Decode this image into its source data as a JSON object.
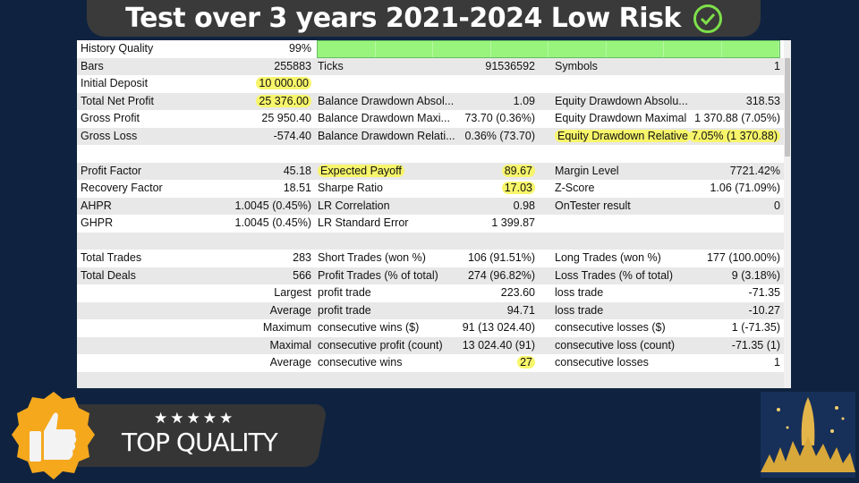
{
  "title": "Test over 3 years 2021-2024 Low Risk",
  "colors": {
    "background": "#0f2340",
    "highlight": "#f7f56a",
    "quality_bar": "#98f47c",
    "badge": "#f5a81c"
  },
  "badge": {
    "stars": "★★★★★",
    "label": "TOP QUALITY",
    "icon": "thumbs-up-icon"
  },
  "history_quality": {
    "label": "History Quality",
    "value": "99%",
    "percent": 99
  },
  "rows": [
    [
      "Bars",
      "255883",
      "Ticks",
      "91536592",
      "Symbols",
      "1"
    ],
    [
      "Initial Deposit",
      "10 000.00",
      "",
      "",
      "",
      ""
    ],
    [
      "Total Net Profit",
      "25 376.00",
      "Balance Drawdown Absol...",
      "1.09",
      "Equity Drawdown Absolu...",
      "318.53"
    ],
    [
      "Gross Profit",
      "25 950.40",
      "Balance Drawdown Maxi...",
      "73.70 (0.36%)",
      "Equity Drawdown Maximal",
      "1 370.88 (7.05%)"
    ],
    [
      "Gross Loss",
      "-574.40",
      "Balance Drawdown Relati...",
      "0.36% (73.70)",
      "Equity Drawdown Relative",
      "7.05% (1 370.88)"
    ],
    [
      "",
      "",
      "",
      "",
      "",
      ""
    ],
    [
      "Profit Factor",
      "45.18",
      "Expected Payoff",
      "89.67",
      "Margin Level",
      "7721.42%"
    ],
    [
      "Recovery Factor",
      "18.51",
      "Sharpe Ratio",
      "17.03",
      "Z-Score",
      "1.06 (71.09%)"
    ],
    [
      "AHPR",
      "1.0045 (0.45%)",
      "LR Correlation",
      "0.98",
      "OnTester result",
      "0"
    ],
    [
      "GHPR",
      "1.0045 (0.45%)",
      "LR Standard Error",
      "1 399.87",
      "",
      ""
    ],
    [
      "",
      "",
      "",
      "",
      "",
      ""
    ],
    [
      "Total Trades",
      "283",
      "Short Trades (won %)",
      "106 (91.51%)",
      "Long Trades (won %)",
      "177 (100.00%)"
    ],
    [
      "Total Deals",
      "566",
      "Profit Trades (% of total)",
      "274 (96.82%)",
      "Loss Trades (% of total)",
      "9 (3.18%)"
    ],
    [
      "",
      "Largest",
      "profit trade",
      "223.60",
      "loss trade",
      "-71.35"
    ],
    [
      "",
      "Average",
      "profit trade",
      "94.71",
      "loss trade",
      "-10.27"
    ],
    [
      "",
      "Maximum",
      "consecutive wins ($)",
      "91 (13 024.40)",
      "consecutive losses ($)",
      "1 (-71.35)"
    ],
    [
      "",
      "Maximal",
      "consecutive profit (count)",
      "13 024.40 (91)",
      "consecutive loss (count)",
      "-71.35 (1)"
    ],
    [
      "",
      "Average",
      "consecutive wins",
      "27",
      "consecutive losses",
      "1"
    ],
    [
      "",
      "",
      "",
      "",
      "",
      ""
    ]
  ],
  "highlighted": [
    "1.1",
    "2.1",
    "4.4",
    "4.5",
    "6.2",
    "6.3",
    "7.3",
    "17.3"
  ]
}
